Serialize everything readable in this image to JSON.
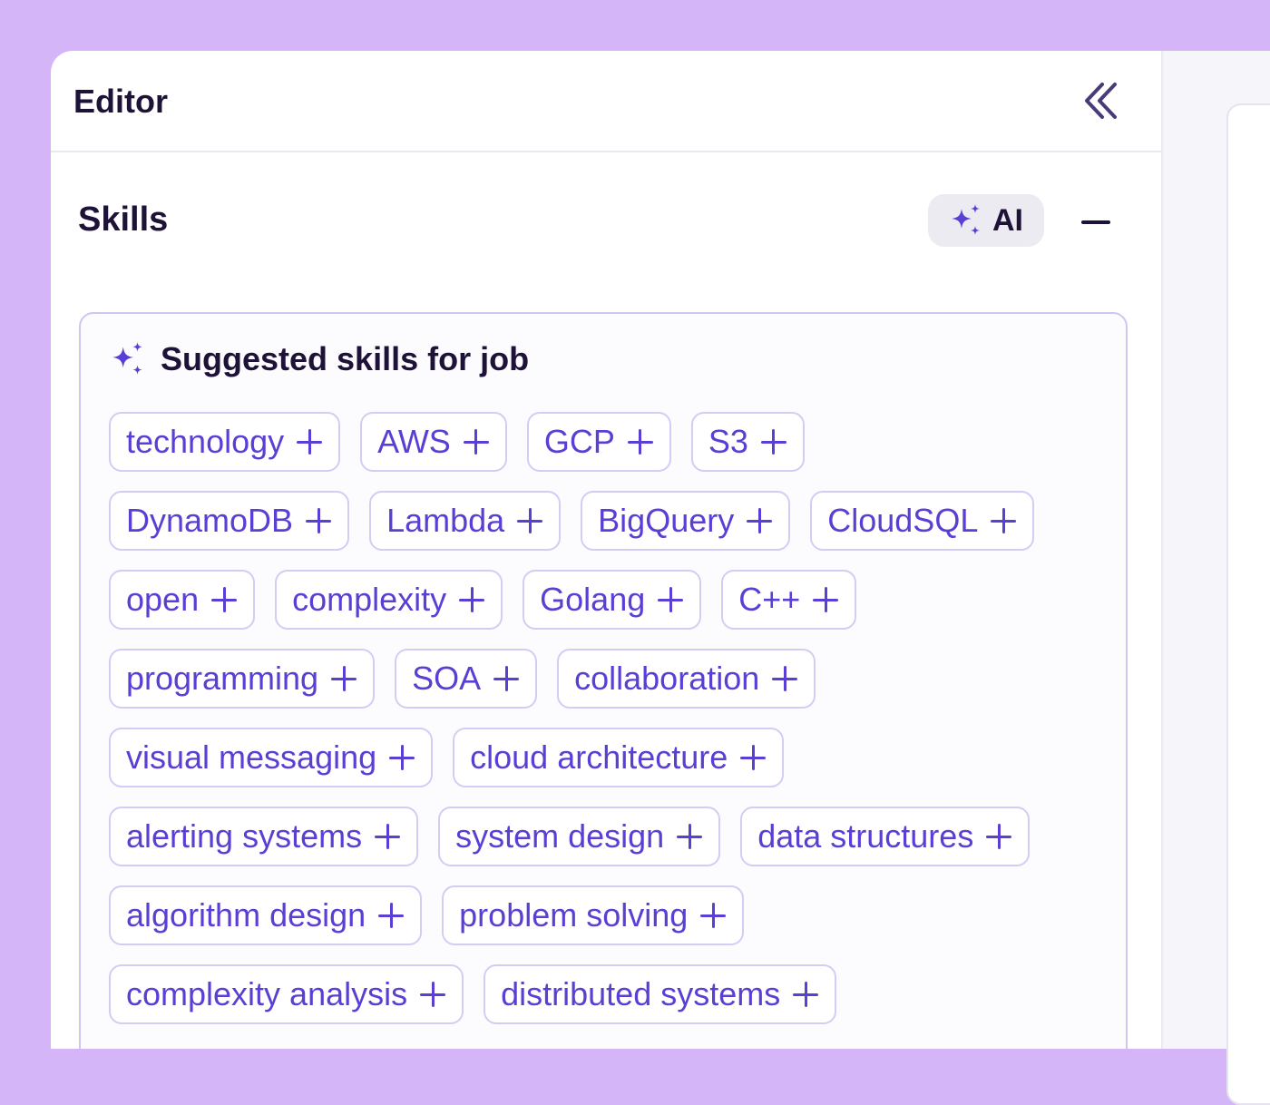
{
  "editor": {
    "title": "Editor"
  },
  "skills": {
    "title": "Skills",
    "ai_label": "AI"
  },
  "suggestions": {
    "heading": "Suggested skills for job",
    "rows": [
      [
        "technology",
        "AWS",
        "GCP",
        "S3"
      ],
      [
        "DynamoDB",
        "Lambda",
        "BigQuery",
        "CloudSQL"
      ],
      [
        "open",
        "complexity",
        "Golang",
        "C++"
      ],
      [
        "programming",
        "SOA",
        "collaboration"
      ],
      [
        "visual messaging",
        "cloud architecture"
      ],
      [
        "alerting systems",
        "system design",
        "data structures"
      ],
      [
        "algorithm design",
        "problem solving"
      ],
      [
        "complexity analysis",
        "distributed systems"
      ]
    ]
  },
  "colors": {
    "background": "#d4b6f8",
    "accent": "#5b3fd4",
    "text_dark": "#1e1238",
    "chip_border": "#d4ccf4"
  },
  "icons": {
    "collapse": "double-chevron-left-icon",
    "ai": "sparkles-icon",
    "minus": "minus-icon",
    "plus": "plus-icon"
  }
}
